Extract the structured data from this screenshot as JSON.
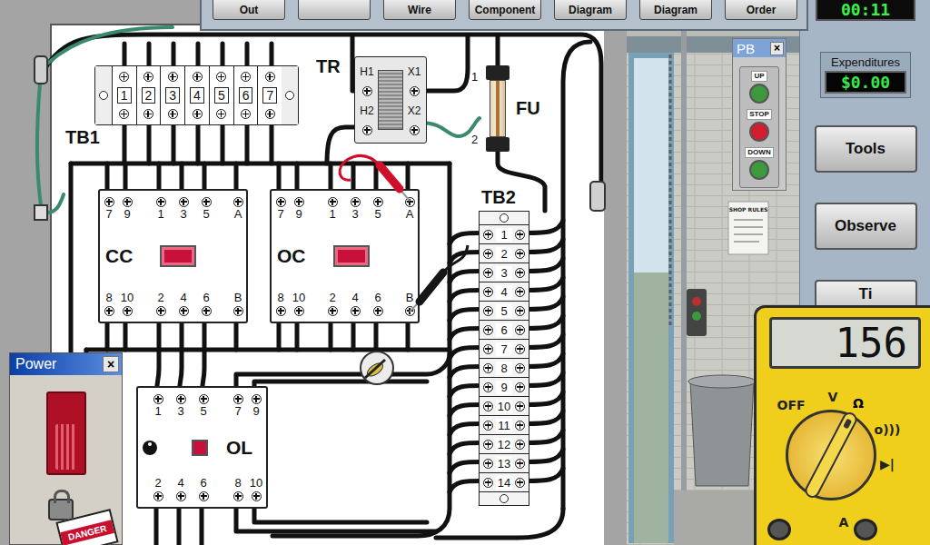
{
  "toolbar": {
    "buttons": [
      "Out",
      "",
      "Wire",
      "Component",
      "Diagram",
      "Diagram",
      "Order"
    ]
  },
  "timer": "00:11",
  "expenditures": {
    "label": "Expenditures",
    "value": "$0.00"
  },
  "side_buttons": [
    "Tools",
    "Observe",
    "Ti"
  ],
  "panel": {
    "components": [
      {
        "kind": "terminal_block",
        "label": "TB1",
        "terminals": [
          "1",
          "2",
          "3",
          "4",
          "5",
          "6",
          "7"
        ]
      },
      {
        "kind": "transformer",
        "label": "TR",
        "terminals": [
          "H1",
          "H2",
          "X1",
          "X2"
        ]
      },
      {
        "kind": "fuse",
        "label": "FU",
        "terminals": [
          "1",
          "2"
        ]
      },
      {
        "kind": "contactor",
        "label": "CC",
        "top": [
          "7",
          "9",
          "1",
          "3",
          "5",
          "A"
        ],
        "bottom": [
          "8",
          "10",
          "2",
          "4",
          "6",
          "B"
        ]
      },
      {
        "kind": "contactor",
        "label": "OC",
        "top": [
          "7",
          "9",
          "1",
          "3",
          "5",
          "A"
        ],
        "bottom": [
          "8",
          "10",
          "2",
          "4",
          "6",
          "B"
        ]
      },
      {
        "kind": "terminal_strip",
        "label": "TB2",
        "terminals": [
          "1",
          "2",
          "3",
          "4",
          "5",
          "6",
          "7",
          "8",
          "9",
          "10",
          "11",
          "12",
          "13",
          "14"
        ]
      },
      {
        "kind": "overload",
        "label": "OL",
        "top": [
          "1",
          "3",
          "5",
          "7",
          "9"
        ],
        "bottom": [
          "2",
          "4",
          "6",
          "8",
          "10"
        ]
      }
    ]
  },
  "pushbutton_station": {
    "title": "PB",
    "close": "×",
    "buttons": [
      {
        "label": "UP",
        "color": "#3c9a3c"
      },
      {
        "label": "STOP",
        "color": "#d01e30"
      },
      {
        "label": "DOWN",
        "color": "#3c9a3c"
      }
    ]
  },
  "power": {
    "title": "Power",
    "close": "×",
    "on": false,
    "locked_out": true,
    "tag": "DANGER"
  },
  "multimeter": {
    "reading": "156",
    "dial": [
      {
        "label": "OFF",
        "selected": false
      },
      {
        "label": "V",
        "selected": false
      },
      {
        "label": "Ω",
        "selected": true
      },
      {
        "label": "o)))",
        "selected": false
      },
      {
        "label": "▶|",
        "selected": false
      },
      {
        "label": "A",
        "selected": false
      }
    ],
    "leads": [
      {
        "color": "#d0102a"
      },
      {
        "color": "#151515"
      }
    ]
  },
  "scene": {
    "shop_rules": "SHOP RULES",
    "stack_light": [
      {
        "color": "#b83030"
      },
      {
        "color": "#3a9a3a"
      }
    ]
  }
}
